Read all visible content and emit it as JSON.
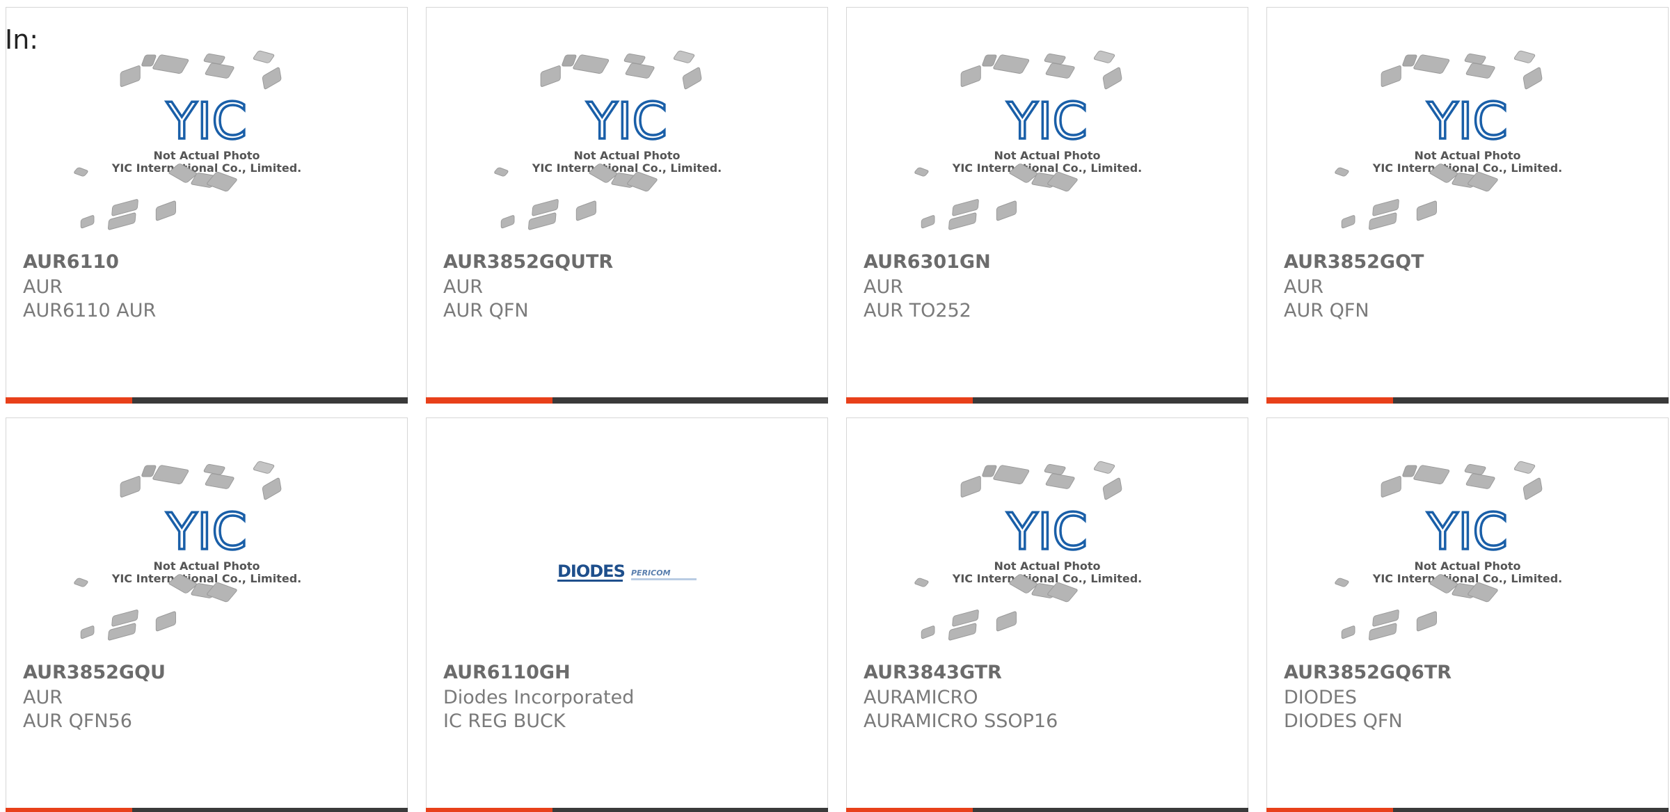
{
  "header": {
    "in_label": "In:"
  },
  "colors": {
    "accent": "#e8401a",
    "bar_dark": "#3a3a3a",
    "logo_blue": "#1a5fa8",
    "text_gray": "#7a7a7a"
  },
  "placeholder": {
    "line1": "Not Actual Photo",
    "line2": "YIC International Co., Limited.",
    "logo": "YIC"
  },
  "diodes_logo": {
    "brand": "DIODES",
    "sub_brand": "PERICOM"
  },
  "products": [
    {
      "part_number": "AUR6110",
      "maker": "AUR",
      "description": "AUR6110 AUR",
      "image": "yic-placeholder"
    },
    {
      "part_number": "AUR3852GQUTR",
      "maker": "AUR",
      "description": "AUR QFN",
      "image": "yic-placeholder"
    },
    {
      "part_number": "AUR6301GN",
      "maker": "AUR",
      "description": "AUR TO252",
      "image": "yic-placeholder"
    },
    {
      "part_number": "AUR3852GQT",
      "maker": "AUR",
      "description": "AUR QFN",
      "image": "yic-placeholder"
    },
    {
      "part_number": "AUR3852GQU",
      "maker": "AUR",
      "description": "AUR QFN56",
      "image": "yic-placeholder"
    },
    {
      "part_number": "AUR6110GH",
      "maker": "Diodes Incorporated",
      "description": "IC REG BUCK",
      "image": "diodes-logo"
    },
    {
      "part_number": "AUR3843GTR",
      "maker": "AURAMICRO",
      "description": "AURAMICRO SSOP16",
      "image": "yic-placeholder"
    },
    {
      "part_number": "AUR3852GQ6TR",
      "maker": "DIODES",
      "description": "DIODES QFN",
      "image": "yic-placeholder"
    }
  ]
}
